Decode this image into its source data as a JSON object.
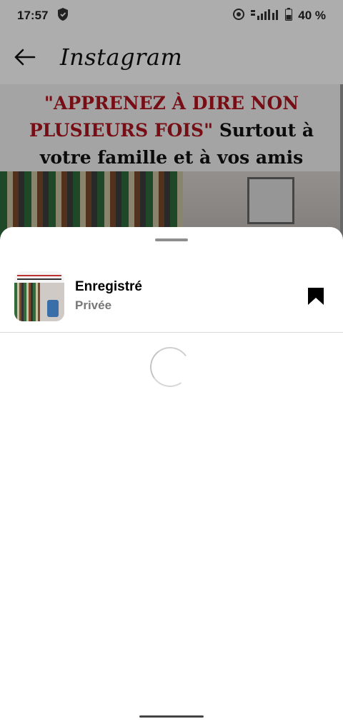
{
  "status_bar": {
    "time": "17:57",
    "battery": "40 %",
    "icons": [
      "shield-icon",
      "sync-icon",
      "signal-icon",
      "battery-icon"
    ]
  },
  "app_header": {
    "title": "Instagram",
    "back_icon": "back-arrow-icon"
  },
  "post": {
    "caption_red": "\"APPRENEZ À DIRE NON PLUSIEURS FOIS\"",
    "caption_black": " Surtout à votre famille et à vos amis quand il s'agit d'affaires !!"
  },
  "sheet": {
    "collection": {
      "title": "Enregistré",
      "subtitle": "Privée",
      "action_icon": "bookmark-filled-icon"
    },
    "loading_icon": "spinner-icon"
  },
  "colors": {
    "caption_red": "#b2161f",
    "sheet_bg": "#ffffff",
    "dim_overlay": "rgba(0,0,0,0.32)"
  }
}
